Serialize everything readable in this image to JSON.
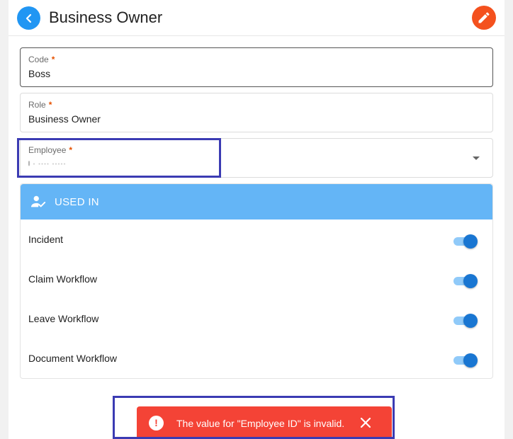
{
  "header": {
    "title": "Business Owner",
    "back_icon": "chevron-left-icon",
    "edit_icon": "pencil-icon",
    "back_color": "#2196f3",
    "edit_color": "#f4511e"
  },
  "form": {
    "code": {
      "label": "Code",
      "required_mark": "*",
      "value": "Boss"
    },
    "role": {
      "label": "Role",
      "required_mark": "*",
      "value": "Business Owner"
    },
    "employee": {
      "label": "Employee",
      "required_mark": "*",
      "value": "l     ·  ····   ·····"
    }
  },
  "used_in": {
    "heading": "USED IN",
    "icon": "user-check-icon",
    "color": "#64b5f6",
    "items": [
      {
        "label": "Incident",
        "enabled": true
      },
      {
        "label": "Claim Workflow",
        "enabled": true
      },
      {
        "label": "Leave Workflow",
        "enabled": true
      },
      {
        "label": "Document Workflow",
        "enabled": true
      }
    ]
  },
  "snackbar": {
    "message": "The value for \"Employee ID\" is invalid.",
    "icon": "error-icon",
    "close_icon": "close-icon",
    "color": "#f44336"
  }
}
